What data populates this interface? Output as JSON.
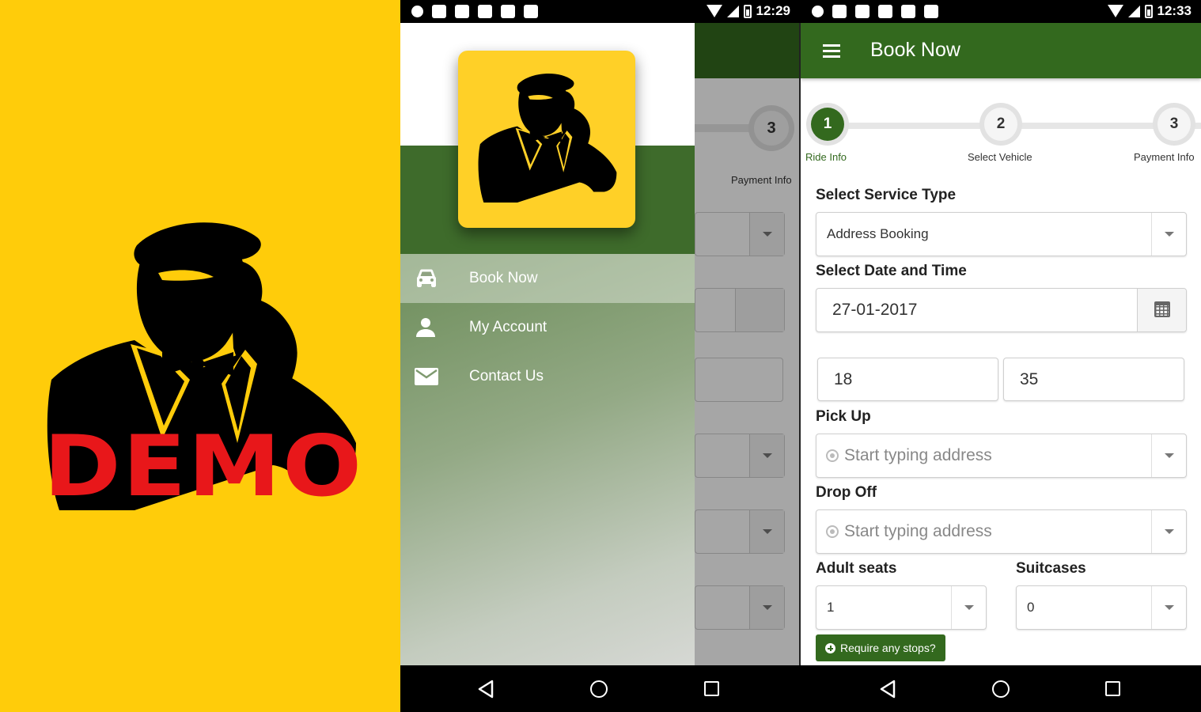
{
  "splash": {
    "demo_text": "DEMO"
  },
  "drawer_screen": {
    "status_time": "12:29",
    "behind_step_number": "3",
    "behind_step_label": "Payment Info",
    "menu": [
      {
        "label": "Book Now",
        "icon": "car-icon",
        "active": true
      },
      {
        "label": "My Account",
        "icon": "person-icon",
        "active": false
      },
      {
        "label": "Contact Us",
        "icon": "envelope-icon",
        "active": false
      }
    ]
  },
  "book_screen": {
    "status_time": "12:33",
    "title": "Book Now",
    "steps": [
      {
        "number": "1",
        "label": "Ride Info",
        "active": true
      },
      {
        "number": "2",
        "label": "Select Vehicle",
        "active": false
      },
      {
        "number": "3",
        "label": "Payment Info",
        "active": false
      }
    ],
    "service_type": {
      "label": "Select Service Type",
      "value": "Address Booking"
    },
    "date_time": {
      "label": "Select Date and Time",
      "date": "27-01-2017",
      "hour": "18",
      "minute": "35"
    },
    "pickup": {
      "label": "Pick Up",
      "placeholder": "Start typing address"
    },
    "dropoff": {
      "label": "Drop Off",
      "placeholder": "Start typing address"
    },
    "adult_seats": {
      "label": "Adult seats",
      "value": "1"
    },
    "suitcases": {
      "label": "Suitcases",
      "value": "0"
    },
    "stops_button": "Require any stops?"
  },
  "colors": {
    "brand_green": "#33691E",
    "splash_yellow": "#FFCC0A",
    "demo_red": "#E8171A"
  }
}
